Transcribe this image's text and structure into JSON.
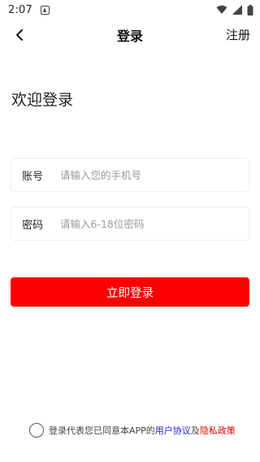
{
  "status_bar": {
    "time": "2:07"
  },
  "nav": {
    "title": "登录",
    "register_label": "注册"
  },
  "welcome_text": "欢迎登录",
  "account_field": {
    "label": "账号",
    "placeholder": "请输入您的手机号"
  },
  "password_field": {
    "label": "密码",
    "placeholder": "请输入6-18位密码"
  },
  "login_button_label": "立即登录",
  "agreement": {
    "prefix": "登录代表您已同意本APP的",
    "user_agreement": "用户协议",
    "conjunction": "及",
    "privacy_policy": "隐私政策"
  },
  "colors": {
    "accent": "#fb0000",
    "user_link": "#1a1ad9",
    "privacy_link": "#e00000"
  },
  "icons": [
    "notification-icon",
    "wifi-icon",
    "signal-icon",
    "battery-icon",
    "back-arrow-icon"
  ]
}
